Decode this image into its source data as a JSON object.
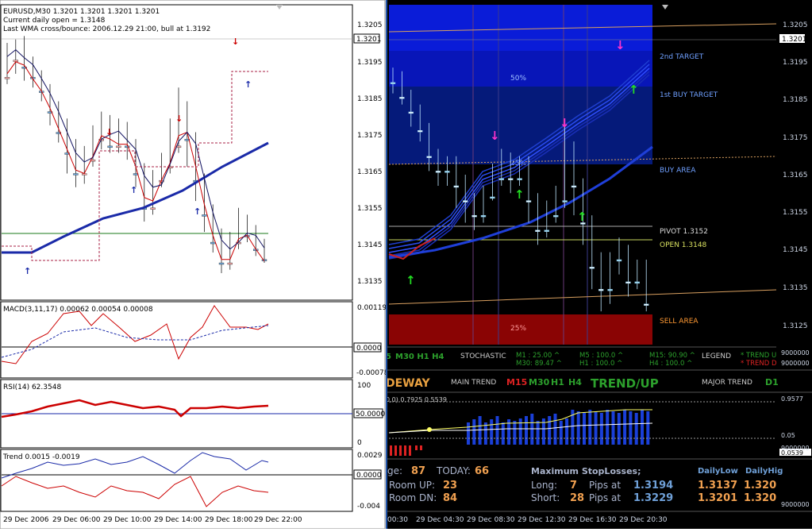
{
  "left": {
    "header": {
      "symbol": "EURUSD,M30  1.3201  1.3201  1.3201  1.3201",
      "daily_open": "Current daily open = 1.3148",
      "wma_note": "Last WMA cross/bounce: 2006.12.29 21:00, bull at 1.3192"
    },
    "price_axis": [
      "1.3205",
      "1.3195",
      "1.3185",
      "1.3175",
      "1.3165",
      "1.3155",
      "1.3145",
      "1.3135"
    ],
    "current_price": "1.3201",
    "macd": {
      "label": "MACD(3,11,17) 0.00062 0.00054 0.00008",
      "axis": [
        "0.00119",
        "0.0000",
        "-0.00078"
      ]
    },
    "rsi": {
      "label": "RSI(14) 62.3548",
      "axis": [
        "100",
        "50.0000",
        "0"
      ]
    },
    "trend": {
      "label": "Trend 0.0015 -0.0019",
      "axis": [
        "0.0029",
        "0.0000",
        "-0.004"
      ]
    },
    "time_axis": [
      "29 Dec 2006",
      "29 Dec 06:00",
      "29 Dec 10:00",
      "29 Dec 14:00",
      "29 Dec 18:00",
      "29 Dec 22:00"
    ]
  },
  "right": {
    "price_axis": [
      "1.3205",
      "1.3195",
      "1.3185",
      "1.3175",
      "1.3165",
      "1.3155",
      "1.3145",
      "1.3135",
      "1.3125"
    ],
    "current_price": "1.3201",
    "zone_labels": {
      "target2": "2nd TARGET",
      "target1": "1st BUY TARGET",
      "buy_area": "BUY AREA",
      "pivot": "PIVOT 1.3152",
      "open": "OPEN 1.3148",
      "sell_area": "SELL AREA",
      "pct50": "50%",
      "pct25a": "25%",
      "pct25b": "25%"
    },
    "stoch_bar": {
      "tfs": "M30 H1 H4",
      "prefix": "5",
      "title": "STOCHASTIC",
      "m1": "M1  : 25.00 ^",
      "m30": "M30: 89.47 ^",
      "m5": "M5 : 100.0 ^",
      "h1": "H1  : 100.0 ^",
      "m15": "M15: 90.90 ^",
      "h4": "H4  : 100.0 ^",
      "legend": "LEGEND",
      "trend_up": "* TREND U",
      "trend_dn": "* TREND D",
      "axis_top": "9000000",
      "axis_bot": "9000000"
    },
    "trend_bar": {
      "sideway": "DEWAY",
      "main_trend": "MAIN TREND",
      "m15": "M15",
      "m30": "M30",
      "h1": "H1",
      "h4": "H4",
      "trend_up": "TREND/UP",
      "major_trend": "MAJOR TREND",
      "d1": "D1"
    },
    "sub_indicator": {
      "label": "0,0) 0.7925 0.5539",
      "axis": [
        "0.9577",
        "0.05",
        "0.0539",
        "9000000"
      ]
    },
    "stats": {
      "range_label": "ge:",
      "range_val": "87",
      "today_label": "TODAY:",
      "today_val": "66",
      "room_up_label": "Room UP:",
      "room_up": "23",
      "room_dn_label": "Room DN:",
      "room_dn": "84",
      "max_sl": "Maximum StopLosses;",
      "long_label": "Long:",
      "long_val": "7",
      "short_label": "Short:",
      "short_val": "28",
      "pips_at": "Pips at",
      "long_price": "1.3194",
      "short_price": "1.3229",
      "daily_low": "DailyLow",
      "daily_high": "DailyHig",
      "low1": "1.3137",
      "high1": "1.320",
      "low2": "1.3201",
      "high2": "1.320",
      "axis": "9000000"
    },
    "time_axis": [
      "00:30",
      "29 Dec 04:30",
      "29 Dec 08:30",
      "29 Dec 12:30",
      "29 Dec 16:30",
      "29 Dec 20:30"
    ]
  },
  "chart_data": [
    {
      "type": "line",
      "title": "EURUSD,M30",
      "ylim": [
        1.313,
        1.321
      ],
      "x": [
        "29 Dec 2006",
        "29 Dec 06:00",
        "29 Dec 10:00",
        "29 Dec 14:00",
        "29 Dec 18:00",
        "29 Dec 22:00"
      ],
      "series": [
        {
          "name": "",
          "values": [
            1.3143,
            1.3158,
            1.317,
            1.3166,
            1.3189,
            1.3199
          ]
        },
        {
          "name": "",
          "values": [
            1.3142,
            1.3151,
            1.316,
            1.3166,
            1.318,
            1.3194
          ]
        },
        {
          "name": "",
          "values": [
            1.3142,
            1.3145,
            1.3151,
            1.3156,
            1.3164,
            1.3173
          ]
        }
      ]
    },
    {
      "type": "line",
      "title": "MACD(3,11,17)",
      "ylim": [
        -0.00078,
        0.00119
      ],
      "series": [
        {
          "name": "",
          "values": [
            0.00062,
            0.00054,
            8e-05
          ]
        }
      ]
    },
    {
      "type": "line",
      "title": "RSI(14)",
      "ylim": [
        0,
        100
      ],
      "series": [
        {
          "name": "",
          "values": [
            62.3548
          ]
        }
      ]
    },
    {
      "type": "line",
      "title": "Trend",
      "ylim": [
        -0.004,
        0.0029
      ],
      "series": [
        {
          "name": "",
          "values": [
            0.0015,
            -0.0019
          ]
        }
      ]
    }
  ],
  "colors": {
    "bull": "#6fa8dc",
    "bear": "#f4a6a6",
    "blueLine": "#1a2aa8",
    "redLine": "#cc0000",
    "accent": "#ff9933"
  }
}
